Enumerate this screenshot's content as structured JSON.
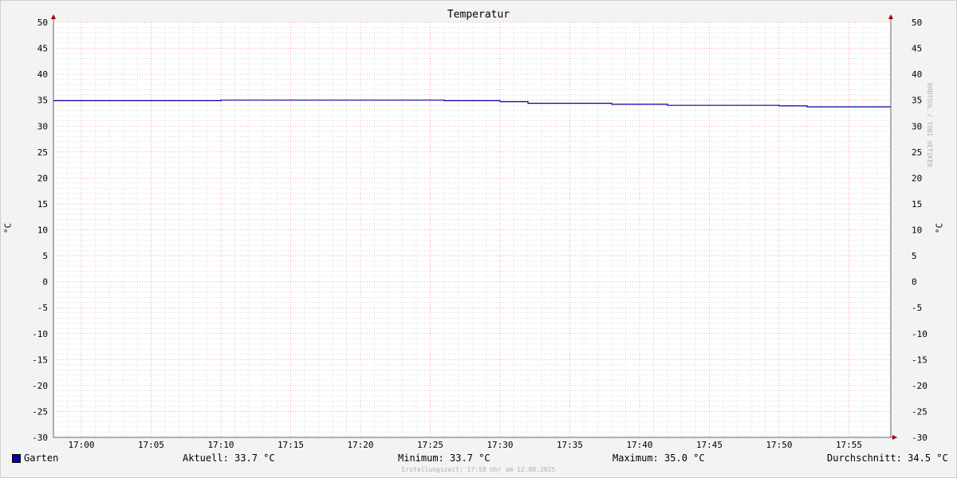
{
  "chart_data": {
    "type": "line",
    "title": "Temperatur",
    "ylabel": "°C",
    "ylim": [
      -30,
      50
    ],
    "yticks": [
      50,
      45,
      40,
      35,
      30,
      25,
      20,
      15,
      10,
      5,
      0,
      -5,
      -10,
      -15,
      -20,
      -25,
      -30
    ],
    "xlim": [
      "16:58",
      "17:58"
    ],
    "xticks": [
      "17:00",
      "17:05",
      "17:10",
      "17:15",
      "17:20",
      "17:25",
      "17:30",
      "17:35",
      "17:40",
      "17:45",
      "17:50",
      "17:55"
    ],
    "grid": true,
    "series": [
      {
        "name": "Garten",
        "color": "#0000aa",
        "points": [
          [
            "16:58",
            34.9
          ],
          [
            "17:10",
            35.0
          ],
          [
            "17:26",
            34.9
          ],
          [
            "17:30",
            34.7
          ],
          [
            "17:32",
            34.4
          ],
          [
            "17:38",
            34.2
          ],
          [
            "17:42",
            34.0
          ],
          [
            "17:50",
            33.9
          ],
          [
            "17:52",
            33.7
          ],
          [
            "17:58",
            33.7
          ]
        ]
      }
    ]
  },
  "legend": {
    "series_name": "Garten",
    "aktuell": "Aktuell: 33.7 °C",
    "minimum": "Minimum: 33.7 °C",
    "maximum": "Maximum: 35.0 °C",
    "durchschnitt": "Durchschnitt: 34.5 °C"
  },
  "footer": "Erstellungszeit: 17:58 Uhr am 12.08.2025",
  "watermark": "RRDTOOL / TOBI OETIKER",
  "colors": {
    "line": "#0000aa",
    "major_grid": "#ff9999",
    "minor_grid": "#c8c8c8",
    "axis_arrow": "#990000"
  }
}
